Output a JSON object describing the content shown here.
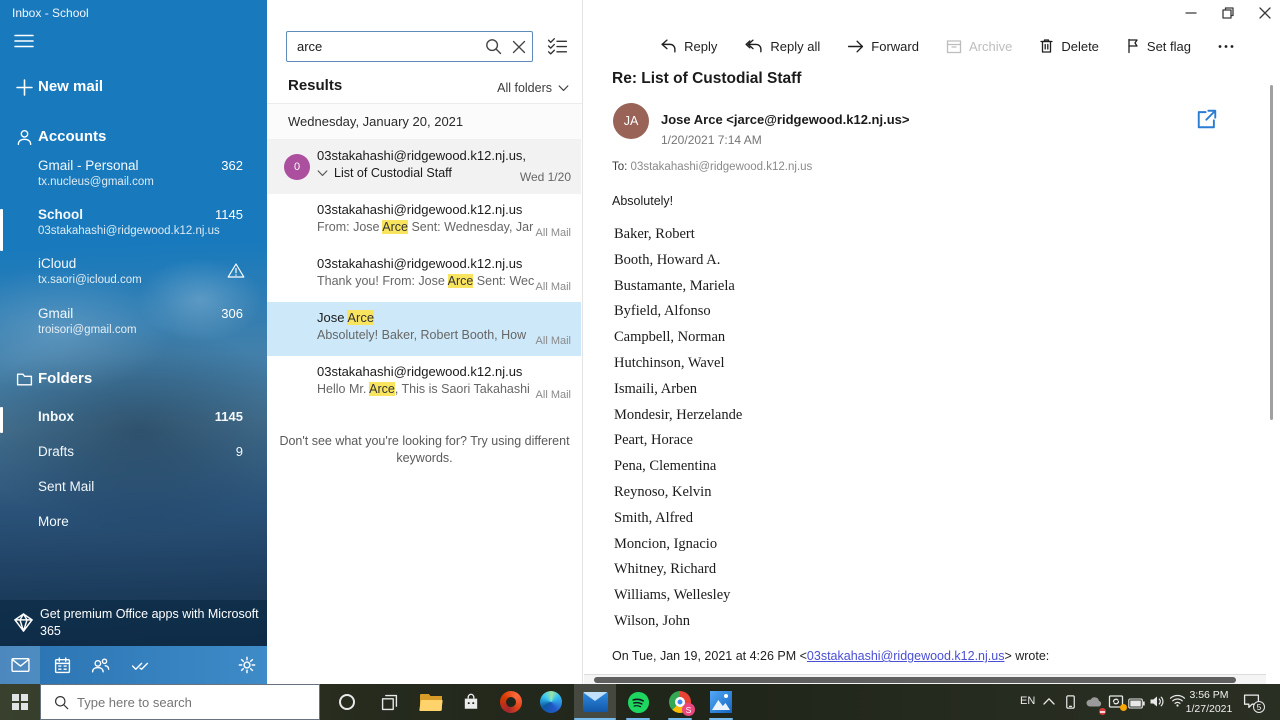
{
  "window": {
    "title": "Inbox - School"
  },
  "sidebar": {
    "new_mail_label": "New mail",
    "accounts_label": "Accounts",
    "accounts": [
      {
        "name": "Gmail - Personal",
        "email": "tx.nucleus@gmail.com",
        "count": "362"
      },
      {
        "name": "School",
        "email": "03stakahashi@ridgewood.k12.nj.us",
        "count": "1145"
      },
      {
        "name": "iCloud",
        "email": "tx.saori@icloud.com",
        "count": ""
      },
      {
        "name": "Gmail",
        "email": "troisori@gmail.com",
        "count": "306"
      }
    ],
    "folders_label": "Folders",
    "folders": [
      {
        "name": "Inbox",
        "count": "1145"
      },
      {
        "name": "Drafts",
        "count": "9"
      },
      {
        "name": "Sent Mail",
        "count": ""
      },
      {
        "name": "More",
        "count": ""
      }
    ],
    "promo_text": "Get premium Office apps with Microsoft 365"
  },
  "search_panel": {
    "query": "arce",
    "results_label": "Results",
    "filter_label": "All folders",
    "date_header": "Wednesday, January 20, 2021",
    "footer_text": "Don't see what you're looking for?  Try using different keywords.",
    "results": [
      {
        "avatar": "0",
        "line1": "03stakahashi@ridgewood.k12.nj.us,",
        "subject": "List of Custodial Staff",
        "date": "Wed 1/20"
      },
      {
        "line1": "03stakahashi@ridgewood.k12.nj.us",
        "preview_pre": "From: Jose ",
        "preview_hl": "Arce",
        "preview_post": " Sent: Wednesday, Jar",
        "folder": "All Mail"
      },
      {
        "line1": "03stakahashi@ridgewood.k12.nj.us",
        "preview_pre": "Thank you! From: Jose ",
        "preview_hl": "Arce",
        "preview_post": " Sent: Wec",
        "folder": "All Mail"
      },
      {
        "line1_pre": "Jose ",
        "line1_hl": "Arce",
        "preview_pre": "Absolutely! Baker, Robert Booth, How",
        "preview_hl": "",
        "preview_post": "",
        "folder": "All Mail"
      },
      {
        "line1": "03stakahashi@ridgewood.k12.nj.us",
        "preview_pre": "Hello Mr. ",
        "preview_hl": "Arce",
        "preview_post": ", This is Saori Takahashi",
        "folder": "All Mail"
      }
    ]
  },
  "toolbar": {
    "reply": "Reply",
    "reply_all": "Reply all",
    "forward": "Forward",
    "archive": "Archive",
    "delete": "Delete",
    "set_flag": "Set flag"
  },
  "message": {
    "subject": "Re: List of Custodial Staff",
    "avatar_initials": "JA",
    "sender": "Jose Arce <jarce@ridgewood.k12.nj.us>",
    "timestamp": "1/20/2021 7:14 AM",
    "to_label": "To: ",
    "to_address": "03stakahashi@ridgewood.k12.nj.us",
    "greeting": "Absolutely!",
    "names": [
      "Baker, Robert",
      "Booth, Howard A.",
      "Bustamante, Mariela",
      "Byfield, Alfonso",
      "Campbell, Norman",
      "Hutchinson, Wavel",
      "Ismaili, Arben",
      "Mondesir, Herzelande",
      "Peart, Horace",
      "Pena, Clementina",
      "Reynoso, Kelvin",
      "Smith, Alfred",
      "Moncion, Ignacio",
      "Whitney, Richard",
      "Williams, Wellesley",
      "Wilson, John"
    ],
    "quote_pre": "On Tue, Jan 19, 2021 at 4:26 PM <",
    "quote_link": "03stakahashi@ridgewood.k12.nj.us",
    "quote_post": "> wrote:"
  },
  "taskbar": {
    "search_placeholder": "Type here to search",
    "chrome_badge": "S",
    "tray": {
      "language": "EN",
      "time": "3:56 PM",
      "date": "1/27/2021",
      "notifications": "5"
    }
  },
  "colors": {
    "accent": "#0078d7",
    "selection": "#cde9f9",
    "highlight": "#f9e45f",
    "link": "#4a4fd4",
    "avatar_group": "#ab4f9e",
    "avatar_sender": "#996357",
    "sidebar_top": "#1879bd"
  }
}
